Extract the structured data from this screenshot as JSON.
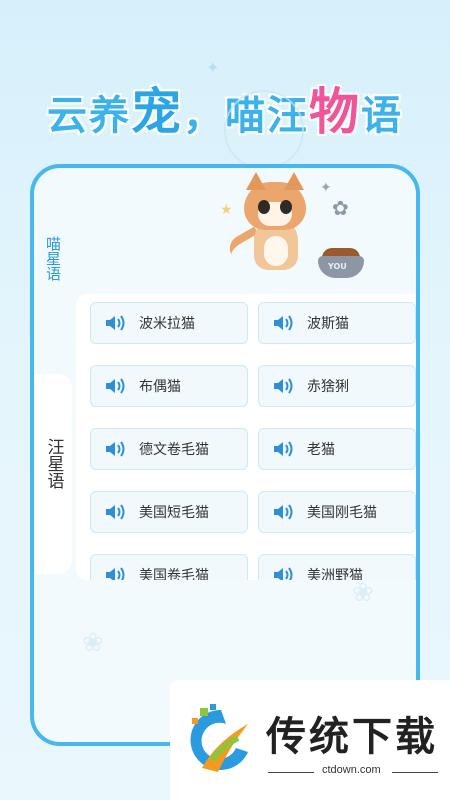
{
  "headline": {
    "part1": "云养",
    "part2": "宠",
    "part3": "，喵汪",
    "part4": "物",
    "part5": "语"
  },
  "side_tabs": {
    "cat": "喵星语",
    "dog": "汪星语"
  },
  "illustration": {
    "bowl_label": "YOU"
  },
  "breeds": [
    "波米拉猫",
    "波斯猫",
    "布偶猫",
    "赤猞猁",
    "德文卷毛猫",
    "老猫",
    "美国短毛猫",
    "美国刚毛猫",
    "美国卷毛猫",
    "美洲野猫"
  ],
  "watermark": {
    "title": "传统下载",
    "url": "ctdown.com"
  },
  "colors": {
    "accent_blue": "#47b8ee",
    "headline_pink": "#f0559a",
    "speaker_blue": "#2e8fd6"
  }
}
